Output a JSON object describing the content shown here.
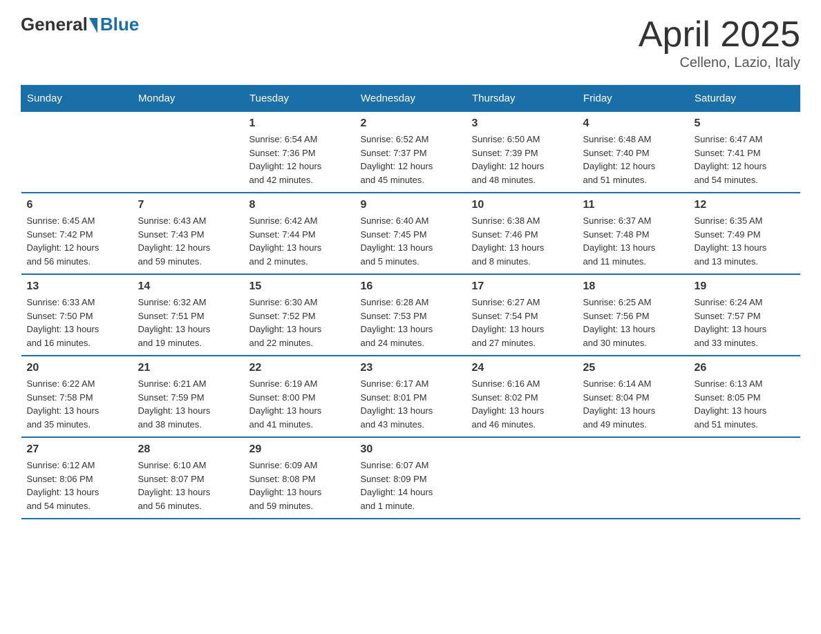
{
  "header": {
    "logo_general": "General",
    "logo_blue": "Blue",
    "month": "April 2025",
    "location": "Celleno, Lazio, Italy"
  },
  "weekdays": [
    "Sunday",
    "Monday",
    "Tuesday",
    "Wednesday",
    "Thursday",
    "Friday",
    "Saturday"
  ],
  "weeks": [
    [
      {
        "day": "",
        "info": ""
      },
      {
        "day": "",
        "info": ""
      },
      {
        "day": "1",
        "info": "Sunrise: 6:54 AM\nSunset: 7:36 PM\nDaylight: 12 hours\nand 42 minutes."
      },
      {
        "day": "2",
        "info": "Sunrise: 6:52 AM\nSunset: 7:37 PM\nDaylight: 12 hours\nand 45 minutes."
      },
      {
        "day": "3",
        "info": "Sunrise: 6:50 AM\nSunset: 7:39 PM\nDaylight: 12 hours\nand 48 minutes."
      },
      {
        "day": "4",
        "info": "Sunrise: 6:48 AM\nSunset: 7:40 PM\nDaylight: 12 hours\nand 51 minutes."
      },
      {
        "day": "5",
        "info": "Sunrise: 6:47 AM\nSunset: 7:41 PM\nDaylight: 12 hours\nand 54 minutes."
      }
    ],
    [
      {
        "day": "6",
        "info": "Sunrise: 6:45 AM\nSunset: 7:42 PM\nDaylight: 12 hours\nand 56 minutes."
      },
      {
        "day": "7",
        "info": "Sunrise: 6:43 AM\nSunset: 7:43 PM\nDaylight: 12 hours\nand 59 minutes."
      },
      {
        "day": "8",
        "info": "Sunrise: 6:42 AM\nSunset: 7:44 PM\nDaylight: 13 hours\nand 2 minutes."
      },
      {
        "day": "9",
        "info": "Sunrise: 6:40 AM\nSunset: 7:45 PM\nDaylight: 13 hours\nand 5 minutes."
      },
      {
        "day": "10",
        "info": "Sunrise: 6:38 AM\nSunset: 7:46 PM\nDaylight: 13 hours\nand 8 minutes."
      },
      {
        "day": "11",
        "info": "Sunrise: 6:37 AM\nSunset: 7:48 PM\nDaylight: 13 hours\nand 11 minutes."
      },
      {
        "day": "12",
        "info": "Sunrise: 6:35 AM\nSunset: 7:49 PM\nDaylight: 13 hours\nand 13 minutes."
      }
    ],
    [
      {
        "day": "13",
        "info": "Sunrise: 6:33 AM\nSunset: 7:50 PM\nDaylight: 13 hours\nand 16 minutes."
      },
      {
        "day": "14",
        "info": "Sunrise: 6:32 AM\nSunset: 7:51 PM\nDaylight: 13 hours\nand 19 minutes."
      },
      {
        "day": "15",
        "info": "Sunrise: 6:30 AM\nSunset: 7:52 PM\nDaylight: 13 hours\nand 22 minutes."
      },
      {
        "day": "16",
        "info": "Sunrise: 6:28 AM\nSunset: 7:53 PM\nDaylight: 13 hours\nand 24 minutes."
      },
      {
        "day": "17",
        "info": "Sunrise: 6:27 AM\nSunset: 7:54 PM\nDaylight: 13 hours\nand 27 minutes."
      },
      {
        "day": "18",
        "info": "Sunrise: 6:25 AM\nSunset: 7:56 PM\nDaylight: 13 hours\nand 30 minutes."
      },
      {
        "day": "19",
        "info": "Sunrise: 6:24 AM\nSunset: 7:57 PM\nDaylight: 13 hours\nand 33 minutes."
      }
    ],
    [
      {
        "day": "20",
        "info": "Sunrise: 6:22 AM\nSunset: 7:58 PM\nDaylight: 13 hours\nand 35 minutes."
      },
      {
        "day": "21",
        "info": "Sunrise: 6:21 AM\nSunset: 7:59 PM\nDaylight: 13 hours\nand 38 minutes."
      },
      {
        "day": "22",
        "info": "Sunrise: 6:19 AM\nSunset: 8:00 PM\nDaylight: 13 hours\nand 41 minutes."
      },
      {
        "day": "23",
        "info": "Sunrise: 6:17 AM\nSunset: 8:01 PM\nDaylight: 13 hours\nand 43 minutes."
      },
      {
        "day": "24",
        "info": "Sunrise: 6:16 AM\nSunset: 8:02 PM\nDaylight: 13 hours\nand 46 minutes."
      },
      {
        "day": "25",
        "info": "Sunrise: 6:14 AM\nSunset: 8:04 PM\nDaylight: 13 hours\nand 49 minutes."
      },
      {
        "day": "26",
        "info": "Sunrise: 6:13 AM\nSunset: 8:05 PM\nDaylight: 13 hours\nand 51 minutes."
      }
    ],
    [
      {
        "day": "27",
        "info": "Sunrise: 6:12 AM\nSunset: 8:06 PM\nDaylight: 13 hours\nand 54 minutes."
      },
      {
        "day": "28",
        "info": "Sunrise: 6:10 AM\nSunset: 8:07 PM\nDaylight: 13 hours\nand 56 minutes."
      },
      {
        "day": "29",
        "info": "Sunrise: 6:09 AM\nSunset: 8:08 PM\nDaylight: 13 hours\nand 59 minutes."
      },
      {
        "day": "30",
        "info": "Sunrise: 6:07 AM\nSunset: 8:09 PM\nDaylight: 14 hours\nand 1 minute."
      },
      {
        "day": "",
        "info": ""
      },
      {
        "day": "",
        "info": ""
      },
      {
        "day": "",
        "info": ""
      }
    ]
  ]
}
